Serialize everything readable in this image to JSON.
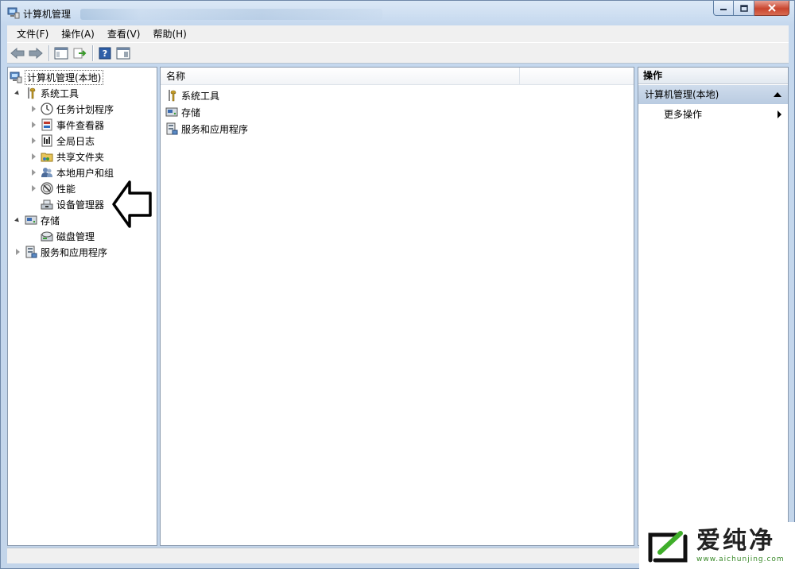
{
  "window": {
    "title": "计算机管理"
  },
  "menu": [
    {
      "label": "文件(F)"
    },
    {
      "label": "操作(A)"
    },
    {
      "label": "查看(V)"
    },
    {
      "label": "帮助(H)"
    }
  ],
  "tree": {
    "root": "计算机管理(本地)",
    "system_tools": "系统工具",
    "task_scheduler": "任务计划程序",
    "event_viewer": "事件查看器",
    "shared_folders": "全局日志",
    "share_folder": "共享文件夹",
    "local_users": "本地用户和组",
    "performance": "性能",
    "device_manager": "设备管理器",
    "storage": "存储",
    "disk_management": "磁盘管理",
    "services_apps": "服务和应用程序"
  },
  "list": {
    "column_name": "名称",
    "items": [
      {
        "label": "系统工具",
        "icon": "tools-icon"
      },
      {
        "label": "存储",
        "icon": "storage-icon"
      },
      {
        "label": "服务和应用程序",
        "icon": "services-icon"
      }
    ]
  },
  "actions": {
    "header": "操作",
    "section": "计算机管理(本地)",
    "more": "更多操作"
  },
  "watermark": {
    "brand": "爱纯净",
    "url": "www.aichunjing.com"
  },
  "colors": {
    "frame": "#c5d8ee",
    "close_button": "#c9452e",
    "action_section": "#cfdcec",
    "watermark_green": "#3a8a2a"
  }
}
